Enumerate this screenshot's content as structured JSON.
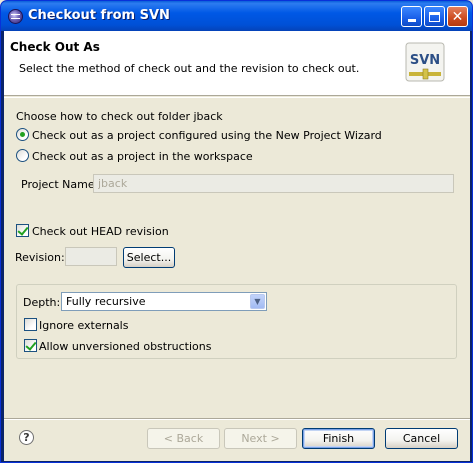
{
  "window": {
    "title": "Checkout from SVN"
  },
  "banner": {
    "title": "Check Out As",
    "description": "Select the method of check out and the revision to check out.",
    "icon_label": "SVN"
  },
  "checkout_method": {
    "heading": "Choose how to check out folder jback",
    "option_wizard": "Check out as a project configured using the New Project Wizard",
    "option_workspace": "Check out as a project in the workspace",
    "project_name_label": "Project Name:",
    "project_name_value": "jback",
    "selected": "wizard"
  },
  "revision": {
    "head_checkbox_label": "Check out HEAD revision",
    "head_checked": true,
    "revision_label": "Revision:",
    "revision_value": "",
    "select_button": "Select..."
  },
  "options": {
    "depth_label": "Depth:",
    "depth_value": "Fully recursive",
    "ignore_externals_label": "Ignore externals",
    "ignore_externals_checked": false,
    "allow_unversioned_label": "Allow unversioned obstructions",
    "allow_unversioned_checked": true
  },
  "footer": {
    "back": "< Back",
    "next": "Next >",
    "finish": "Finish",
    "cancel": "Cancel",
    "help_glyph": "?"
  },
  "icons": {
    "app": "eclipse-icon",
    "svn": "svn-icon",
    "help": "help-icon",
    "minimize": "minimize-icon",
    "maximize": "maximize-icon",
    "close": "close-icon"
  }
}
